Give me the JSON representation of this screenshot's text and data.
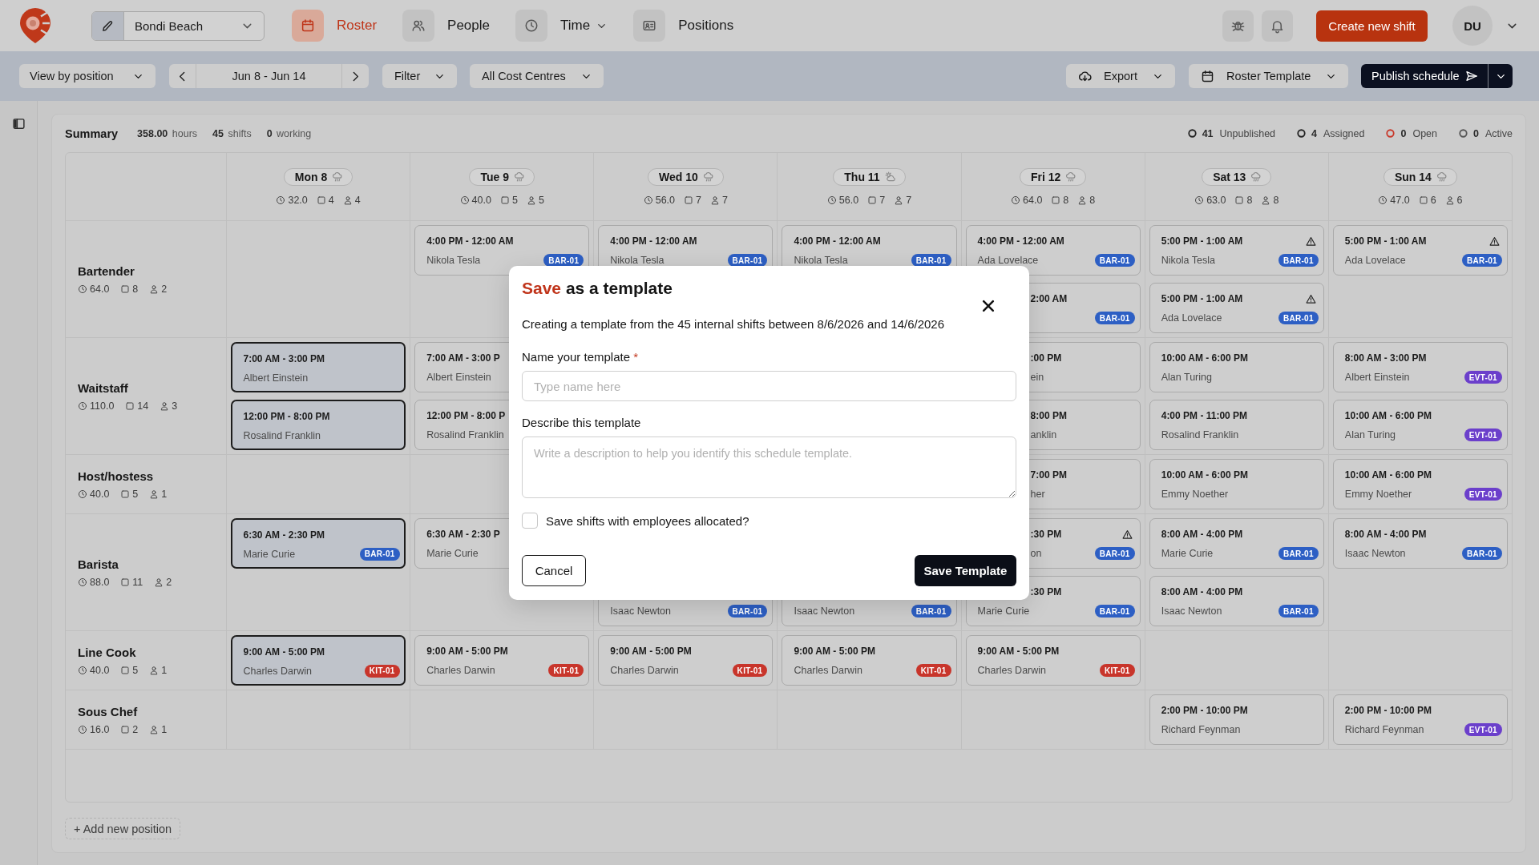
{
  "top_bar": {
    "location": "Bondi Beach",
    "nav": [
      {
        "label": "Roster",
        "selected": true,
        "has_menu": false
      },
      {
        "label": "People",
        "selected": false,
        "has_menu": false
      },
      {
        "label": "Time",
        "selected": false,
        "has_menu": true
      },
      {
        "label": "Positions",
        "selected": false,
        "has_menu": false
      }
    ],
    "create_button": "Create new shift",
    "avatar": "DU"
  },
  "toolbar": {
    "view": "View by position",
    "date_range": "Jun 8 - Jun 14",
    "filter": "Filter",
    "cost_centres": "All Cost Centres",
    "export": "Export",
    "template": "Roster Template",
    "publish": "Publish schedule"
  },
  "summary": {
    "title": "Summary",
    "stats": [
      "**358.00** hours",
      "**45** shifts",
      "**0** working"
    ],
    "statuses": [
      {
        "value": "41",
        "label": "Unpublished",
        "color": "#222222"
      },
      {
        "value": "4",
        "label": "Assigned",
        "color": "#222222"
      },
      {
        "value": "0",
        "label": "Open",
        "color": "#c8382a"
      },
      {
        "value": "0",
        "label": "Active",
        "color": "#555555"
      }
    ]
  },
  "days": [
    {
      "label": "Mon 8",
      "kind": "rain",
      "hours": "32.0",
      "shifts": "4",
      "people": "4"
    },
    {
      "label": "Tue 9",
      "kind": "rain",
      "hours": "40.0",
      "shifts": "5",
      "people": "5"
    },
    {
      "label": "Wed 10",
      "kind": "rain",
      "hours": "56.0",
      "shifts": "7",
      "people": "7"
    },
    {
      "label": "Thu 11",
      "kind": "sunny",
      "hours": "56.0",
      "shifts": "7",
      "people": "7"
    },
    {
      "label": "Fri 12",
      "kind": "rain",
      "hours": "64.0",
      "shifts": "8",
      "people": "8"
    },
    {
      "label": "Sat 13",
      "kind": "rain",
      "hours": "63.0",
      "shifts": "8",
      "people": "8"
    },
    {
      "label": "Sun 14",
      "kind": "rain",
      "hours": "47.0",
      "shifts": "6",
      "people": "6"
    }
  ],
  "positions": [
    {
      "name": "Bartender",
      "hours": "64.0",
      "shifts": "8",
      "people": "2",
      "shifts_by_day": {
        "tue": [
          {
            "time": "4:00 PM - 12:00 AM",
            "name": "Nikola Tesla",
            "badge": {
              "label": "BAR-01",
              "color": "#2d5fc4"
            },
            "warning": false,
            "selected": false
          }
        ],
        "wed": [
          {
            "time": "4:00 PM - 12:00 AM",
            "name": "Nikola Tesla",
            "badge": {
              "label": "BAR-01",
              "color": "#2d5fc4"
            },
            "warning": false,
            "selected": false
          }
        ],
        "thu": [
          {
            "time": "4:00 PM - 12:00 AM",
            "name": "Nikola Tesla",
            "badge": {
              "label": "BAR-01",
              "color": "#2d5fc4"
            },
            "warning": false,
            "selected": false
          }
        ],
        "fri": [
          {
            "time": "4:00 PM - 12:00 AM",
            "name": "Ada Lovelace",
            "badge": {
              "label": "BAR-01",
              "color": "#2d5fc4"
            },
            "warning": false,
            "selected": false
          },
          {
            "time": "2:00 AM",
            "time_start_hidden": true,
            "badge": {
              "label": "BAR-01",
              "color": "#2d5fc4"
            },
            "warning": false,
            "selected": false
          }
        ],
        "sat": [
          {
            "time": "5:00 PM - 1:00 AM",
            "name": "Nikola Tesla",
            "badge": {
              "label": "BAR-01",
              "color": "#2d5fc4"
            },
            "warning": true,
            "selected": false
          },
          {
            "time": "5:00 PM - 1:00 AM",
            "name": "Ada Lovelace",
            "badge": {
              "label": "BAR-01",
              "color": "#2d5fc4"
            },
            "warning": true,
            "selected": false
          }
        ],
        "sun": [
          {
            "time": "5:00 PM - 1:00 AM",
            "name": "Ada Lovelace",
            "badge": {
              "label": "BAR-01",
              "color": "#2d5fc4"
            },
            "warning": true,
            "selected": false
          }
        ]
      }
    },
    {
      "name": "Waitstaff",
      "hours": "110.0",
      "shifts": "14",
      "people": "3",
      "shifts_by_day": {
        "mon": [
          {
            "time": "7:00 AM - 3:00 PM",
            "name": "Albert Einstein",
            "warning": false,
            "selected": true
          },
          {
            "time": "12:00 PM - 8:00 PM",
            "name": "Rosalind Franklin",
            "warning": false,
            "selected": true
          }
        ],
        "tue": [
          {
            "time": "7:00 AM - 3:00 P",
            "name": "Albert Einstein",
            "warning": false,
            "selected": false
          },
          {
            "time": "12:00 PM - 8:00 P",
            "name": "Rosalind Franklin",
            "warning": false,
            "selected": false
          }
        ],
        "fri": [
          {
            "time": ":00 PM",
            "time_start_hidden": true,
            "name": "ein",
            "name_start_hidden": true,
            "warning": false,
            "selected": false
          },
          {
            "time": "8:00 PM",
            "time_start_hidden": true,
            "name": "anklin",
            "name_start_hidden": true,
            "warning": false,
            "selected": false
          }
        ],
        "sat": [
          {
            "time": "10:00 AM - 6:00 PM",
            "name": "Alan Turing",
            "warning": false,
            "selected": false
          },
          {
            "time": "4:00 PM - 11:00 PM",
            "name": "Rosalind Franklin",
            "warning": false,
            "selected": false
          }
        ],
        "sun": [
          {
            "time": "8:00 AM - 3:00 PM",
            "name": "Albert Einstein",
            "badge": {
              "label": "EVT-01",
              "color": "#6b3fcb"
            },
            "warning": false,
            "selected": false
          },
          {
            "time": "10:00 AM - 6:00 PM",
            "name": "Alan Turing",
            "badge": {
              "label": "EVT-01",
              "color": "#6b3fcb"
            },
            "warning": false,
            "selected": false
          }
        ]
      }
    },
    {
      "name": "Host/hostess",
      "hours": "40.0",
      "shifts": "5",
      "people": "1",
      "shifts_by_day": {
        "fri": [
          {
            "time": "7:00 PM",
            "time_start_hidden": true,
            "name": "her",
            "name_start_hidden": true,
            "warning": false,
            "selected": false
          }
        ],
        "sat": [
          {
            "time": "10:00 AM - 6:00 PM",
            "name": "Emmy Noether",
            "warning": false,
            "selected": false
          }
        ],
        "sun": [
          {
            "time": "10:00 AM - 6:00 PM",
            "name": "Emmy Noether",
            "badge": {
              "label": "EVT-01",
              "color": "#6b3fcb"
            },
            "warning": false,
            "selected": false
          }
        ]
      }
    },
    {
      "name": "Barista",
      "hours": "88.0",
      "shifts": "11",
      "people": "2",
      "shifts_by_day": {
        "mon": [
          {
            "time": "6:30 AM - 2:30 PM",
            "name": "Marie Curie",
            "badge": {
              "label": "BAR-01",
              "color": "#2d5fc4"
            },
            "warning": false,
            "selected": true
          }
        ],
        "tue": [
          {
            "time": "6:30 AM - 2:30 P",
            "name": "Marie Curie",
            "warning": false,
            "selected": false
          }
        ],
        "wed": [
          {
            "name": "Isaac Newton",
            "top_hidden": true,
            "badge": {
              "label": "BAR-01",
              "color": "#2d5fc4"
            },
            "warning": false,
            "selected": false
          }
        ],
        "thu": [
          {
            "name": "Isaac Newton",
            "top_hidden": true,
            "badge": {
              "label": "BAR-01",
              "color": "#2d5fc4"
            },
            "warning": false,
            "selected": false
          }
        ],
        "fri": [
          {
            "time": ":30 PM",
            "time_start_hidden": true,
            "name": "on",
            "name_start_hidden": true,
            "badge": {
              "label": "BAR-01",
              "color": "#2d5fc4"
            },
            "warning": true,
            "selected": false
          },
          {
            "time": ":30 PM",
            "time_start_hidden": true,
            "name": "Marie Curie",
            "badge": {
              "label": "BAR-01",
              "color": "#2d5fc4"
            },
            "warning": false,
            "selected": false
          }
        ],
        "sat": [
          {
            "time": "8:00 AM - 4:00 PM",
            "name": "Marie Curie",
            "badge": {
              "label": "BAR-01",
              "color": "#2d5fc4"
            },
            "warning": false,
            "selected": false
          },
          {
            "time": "8:00 AM - 4:00 PM",
            "name": "Isaac Newton",
            "badge": {
              "label": "BAR-01",
              "color": "#2d5fc4"
            },
            "warning": false,
            "selected": false
          }
        ],
        "sun": [
          {
            "time": "8:00 AM - 4:00 PM",
            "name": "Isaac Newton",
            "badge": {
              "label": "BAR-01",
              "color": "#2d5fc4"
            },
            "warning": false,
            "selected": false
          }
        ]
      }
    },
    {
      "name": "Line Cook",
      "hours": "40.0",
      "shifts": "5",
      "people": "1",
      "shifts_by_day": {
        "mon": [
          {
            "time": "9:00 AM - 5:00 PM",
            "name": "Charles Darwin",
            "badge": {
              "label": "KIT-01",
              "color": "#c8352b"
            },
            "warning": false,
            "selected": true
          }
        ],
        "tue": [
          {
            "time": "9:00 AM - 5:00 PM",
            "name": "Charles Darwin",
            "badge": {
              "label": "KIT-01",
              "color": "#c8352b"
            },
            "warning": false,
            "selected": false
          }
        ],
        "wed": [
          {
            "time": "9:00 AM - 5:00 PM",
            "name": "Charles Darwin",
            "badge": {
              "label": "KIT-01",
              "color": "#c8352b"
            },
            "warning": false,
            "selected": false
          }
        ],
        "thu": [
          {
            "time": "9:00 AM - 5:00 PM",
            "name": "Charles Darwin",
            "badge": {
              "label": "KIT-01",
              "color": "#c8352b"
            },
            "warning": false,
            "selected": false
          }
        ],
        "fri": [
          {
            "time": "9:00 AM - 5:00 PM",
            "name": "Charles Darwin",
            "badge": {
              "label": "KIT-01",
              "color": "#c8352b"
            },
            "warning": false,
            "selected": false
          }
        ]
      }
    },
    {
      "name": "Sous Chef",
      "hours": "16.0",
      "shifts": "2",
      "people": "1",
      "shifts_by_day": {
        "sat": [
          {
            "time": "2:00 PM - 10:00 PM",
            "name": "Richard Feynman",
            "warning": false,
            "selected": false
          }
        ],
        "sun": [
          {
            "time": "2:00 PM - 10:00 PM",
            "name": "Richard Feynman",
            "badge": {
              "label": "EVT-01",
              "color": "#6b3fcb"
            },
            "warning": false,
            "selected": false
          }
        ]
      }
    }
  ],
  "add_position": "+ Add new position",
  "dialog": {
    "title_accent": "Save",
    "title": "as a template",
    "description": "Creating a template from the 45 internal shifts between 8/6/2026 and 14/6/2026",
    "name_field": {
      "label": "Name your template",
      "required_mark": "*",
      "placeholder": "Type name here"
    },
    "description_field": {
      "label": "Describe this template",
      "placeholder": "Write a description to help you identify this schedule template."
    },
    "checkbox": {
      "label": "Save shifts with employees allocated?",
      "checked": false
    },
    "buttons": [
      {
        "label": "Cancel",
        "kind": "secondary"
      },
      {
        "label": "Save Template",
        "kind": "primary"
      }
    ]
  }
}
